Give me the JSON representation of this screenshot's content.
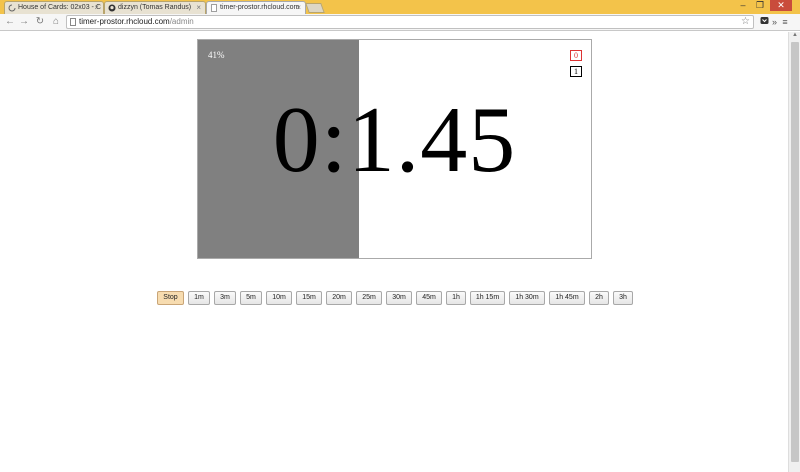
{
  "browser": {
    "tabs": [
      {
        "title": "House of Cards: 02x03 - C"
      },
      {
        "title": "dizzyn (Tomas Randus)"
      },
      {
        "title": "timer-prostor.rhcloud.com"
      }
    ],
    "url_host": "timer-prostor.rhcloud.com",
    "url_path": "/admin"
  },
  "timer": {
    "percent_label": "41%",
    "progress": 0.41,
    "time": "0:1.45",
    "markers": [
      "0",
      "1"
    ]
  },
  "presets": [
    "Stop",
    "1m",
    "3m",
    "5m",
    "10m",
    "15m",
    "20m",
    "25m",
    "30m",
    "45m",
    "1h",
    "1h 15m",
    "1h 30m",
    "1h 45m",
    "2h",
    "3h"
  ],
  "colors": {
    "progress": "#808080",
    "stop_button": "#f7dcb0",
    "marker_red": "#dd3333",
    "title_bar": "#f3c34a"
  }
}
